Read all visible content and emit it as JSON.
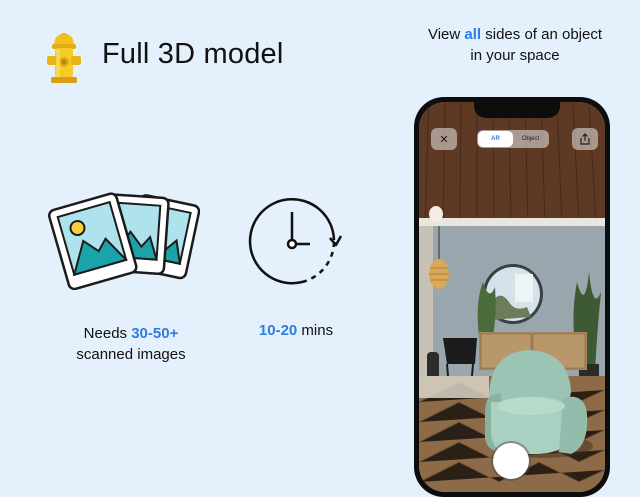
{
  "header": {
    "title": "Full 3D model",
    "tagline_pre": "View ",
    "tagline_accent": "all",
    "tagline_post": " sides of an object in your space"
  },
  "images_stat": {
    "prefix": "Needs ",
    "value": "30-50+",
    "suffix": "scanned images"
  },
  "time_stat": {
    "value": "10-20",
    "suffix": " mins"
  },
  "phone": {
    "toggle_options": [
      "AR",
      "Object"
    ],
    "selected_toggle": "AR",
    "close_icon": "close-icon",
    "share_icon": "share-icon"
  },
  "colors": {
    "background": "#e4f0fb",
    "accent": "#2f7de1",
    "hydrant": "#f2c21b"
  }
}
